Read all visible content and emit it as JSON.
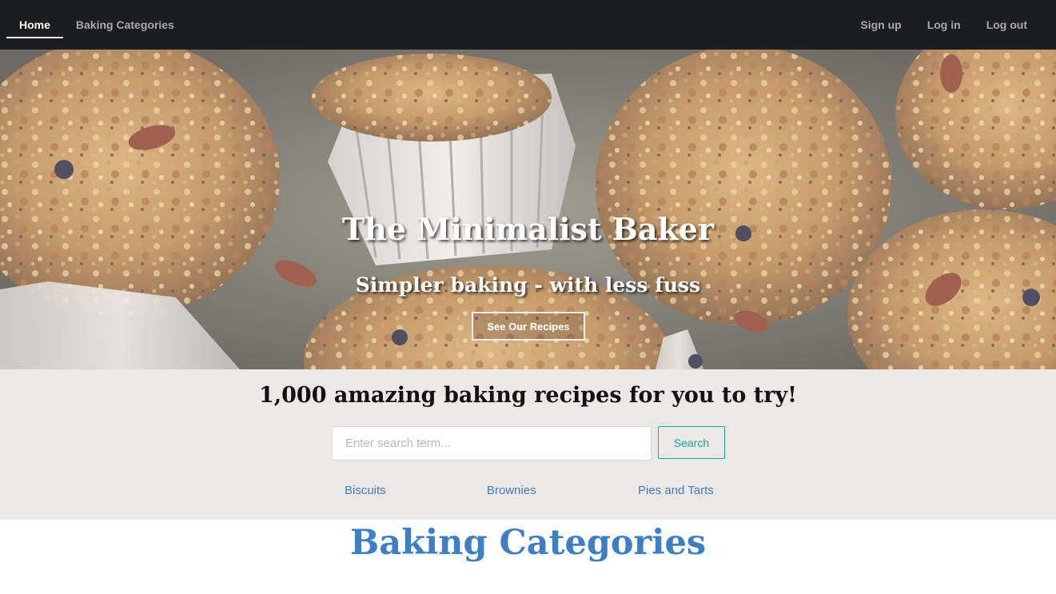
{
  "navbar": {
    "left": [
      {
        "label": "Home",
        "active": true
      },
      {
        "label": "Baking Categories",
        "active": false
      }
    ],
    "right": [
      {
        "label": "Sign up"
      },
      {
        "label": "Log in"
      },
      {
        "label": "Log out"
      }
    ]
  },
  "hero": {
    "title": "The Minimalist Baker",
    "subtitle": "Simpler baking - with less fuss",
    "button_label": "See Our Recipes"
  },
  "search_section": {
    "heading": "1,000 amazing baking recipes for you to try!",
    "input_placeholder": "Enter search term...",
    "input_value": "",
    "button_label": "Search",
    "category_links": [
      "Biscuits",
      "Brownies",
      "Pies and Tarts"
    ]
  },
  "categories_section": {
    "heading": "Baking Categories"
  },
  "colors": {
    "navbar_bg": "#1c1d1f",
    "band_bg": "#ece8e7",
    "link_blue": "#3e7ec2",
    "search_teal": "#1fa596"
  },
  "icons": {
    "hero_image": "muffins-photo"
  }
}
